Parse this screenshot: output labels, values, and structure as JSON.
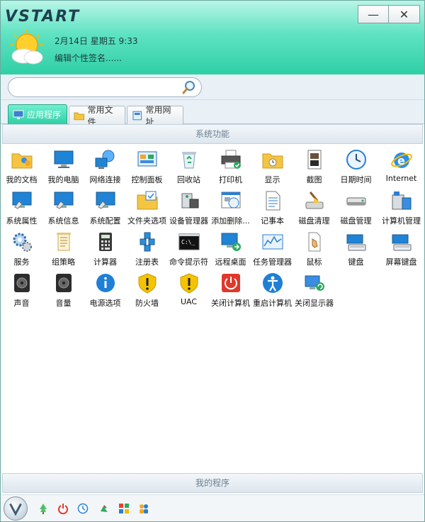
{
  "app": {
    "logo": "VSTART"
  },
  "window_controls": {
    "minimize": "—",
    "close": "✕"
  },
  "header": {
    "date_line": "2月14日  星期五  9:33",
    "signature": "编辑个性签名......"
  },
  "search": {
    "value": "",
    "placeholder": ""
  },
  "tabs": [
    {
      "label": "应用程序",
      "icon": "monitor-icon",
      "active": true
    },
    {
      "label": "常用文件",
      "icon": "folder-icon",
      "active": false
    },
    {
      "label": "常用网址",
      "icon": "webpage-icon",
      "active": false
    }
  ],
  "sections": {
    "system": "系统功能",
    "my_programs": "我的程序"
  },
  "items": [
    {
      "label": "我的文档",
      "icon": "user-folder-icon"
    },
    {
      "label": "我的电脑",
      "icon": "computer-icon"
    },
    {
      "label": "网络连接",
      "icon": "network-icon"
    },
    {
      "label": "控制面板",
      "icon": "control-panel-icon"
    },
    {
      "label": "回收站",
      "icon": "recycle-bin-icon"
    },
    {
      "label": "打印机",
      "icon": "printer-icon"
    },
    {
      "label": "显示",
      "icon": "display-folder-icon"
    },
    {
      "label": "截图",
      "icon": "screenshot-icon"
    },
    {
      "label": "日期时间",
      "icon": "clock-icon"
    },
    {
      "label": "Internet",
      "icon": "ie-icon"
    },
    {
      "label": "系统属性",
      "icon": "system-properties-icon"
    },
    {
      "label": "系统信息",
      "icon": "system-info-icon"
    },
    {
      "label": "系统配置",
      "icon": "system-config-icon"
    },
    {
      "label": "文件夹选项",
      "icon": "folder-options-icon"
    },
    {
      "label": "设备管理器",
      "icon": "device-manager-icon"
    },
    {
      "label": "添加删除...",
      "icon": "add-remove-icon"
    },
    {
      "label": "记事本",
      "icon": "notepad-icon"
    },
    {
      "label": "磁盘清理",
      "icon": "disk-cleanup-icon"
    },
    {
      "label": "磁盘管理",
      "icon": "disk-management-icon"
    },
    {
      "label": "计算机管理",
      "icon": "computer-management-icon"
    },
    {
      "label": "服务",
      "icon": "services-gear-icon"
    },
    {
      "label": "组策略",
      "icon": "group-policy-icon"
    },
    {
      "label": "计算器",
      "icon": "calculator-icon"
    },
    {
      "label": "注册表",
      "icon": "registry-icon"
    },
    {
      "label": "命令提示符",
      "icon": "command-prompt-icon"
    },
    {
      "label": "远程桌面",
      "icon": "remote-desktop-icon"
    },
    {
      "label": "任务管理器",
      "icon": "task-manager-icon"
    },
    {
      "label": "鼠标",
      "icon": "mouse-icon"
    },
    {
      "label": "键盘",
      "icon": "keyboard-icon"
    },
    {
      "label": "屏幕键盘",
      "icon": "onscreen-keyboard-icon"
    },
    {
      "label": "声音",
      "icon": "speaker-icon"
    },
    {
      "label": "音量",
      "icon": "volume-icon"
    },
    {
      "label": "电源选项",
      "icon": "power-info-icon"
    },
    {
      "label": "防火墙",
      "icon": "firewall-shield-icon"
    },
    {
      "label": "UAC",
      "icon": "uac-shield-icon"
    },
    {
      "label": "关闭计算机",
      "icon": "shutdown-icon"
    },
    {
      "label": "重启计算机",
      "icon": "restart-icon"
    },
    {
      "label": "关闭显示器",
      "icon": "monitor-off-icon"
    }
  ],
  "bottom_icons": [
    "start-orb-icon",
    "tree-icon",
    "power-icon",
    "clock-app-icon",
    "bird-icon",
    "tiles-icon",
    "people-icon"
  ],
  "colors": {
    "accent": "#2fcfa6",
    "header_top": "#b8f5e6"
  }
}
